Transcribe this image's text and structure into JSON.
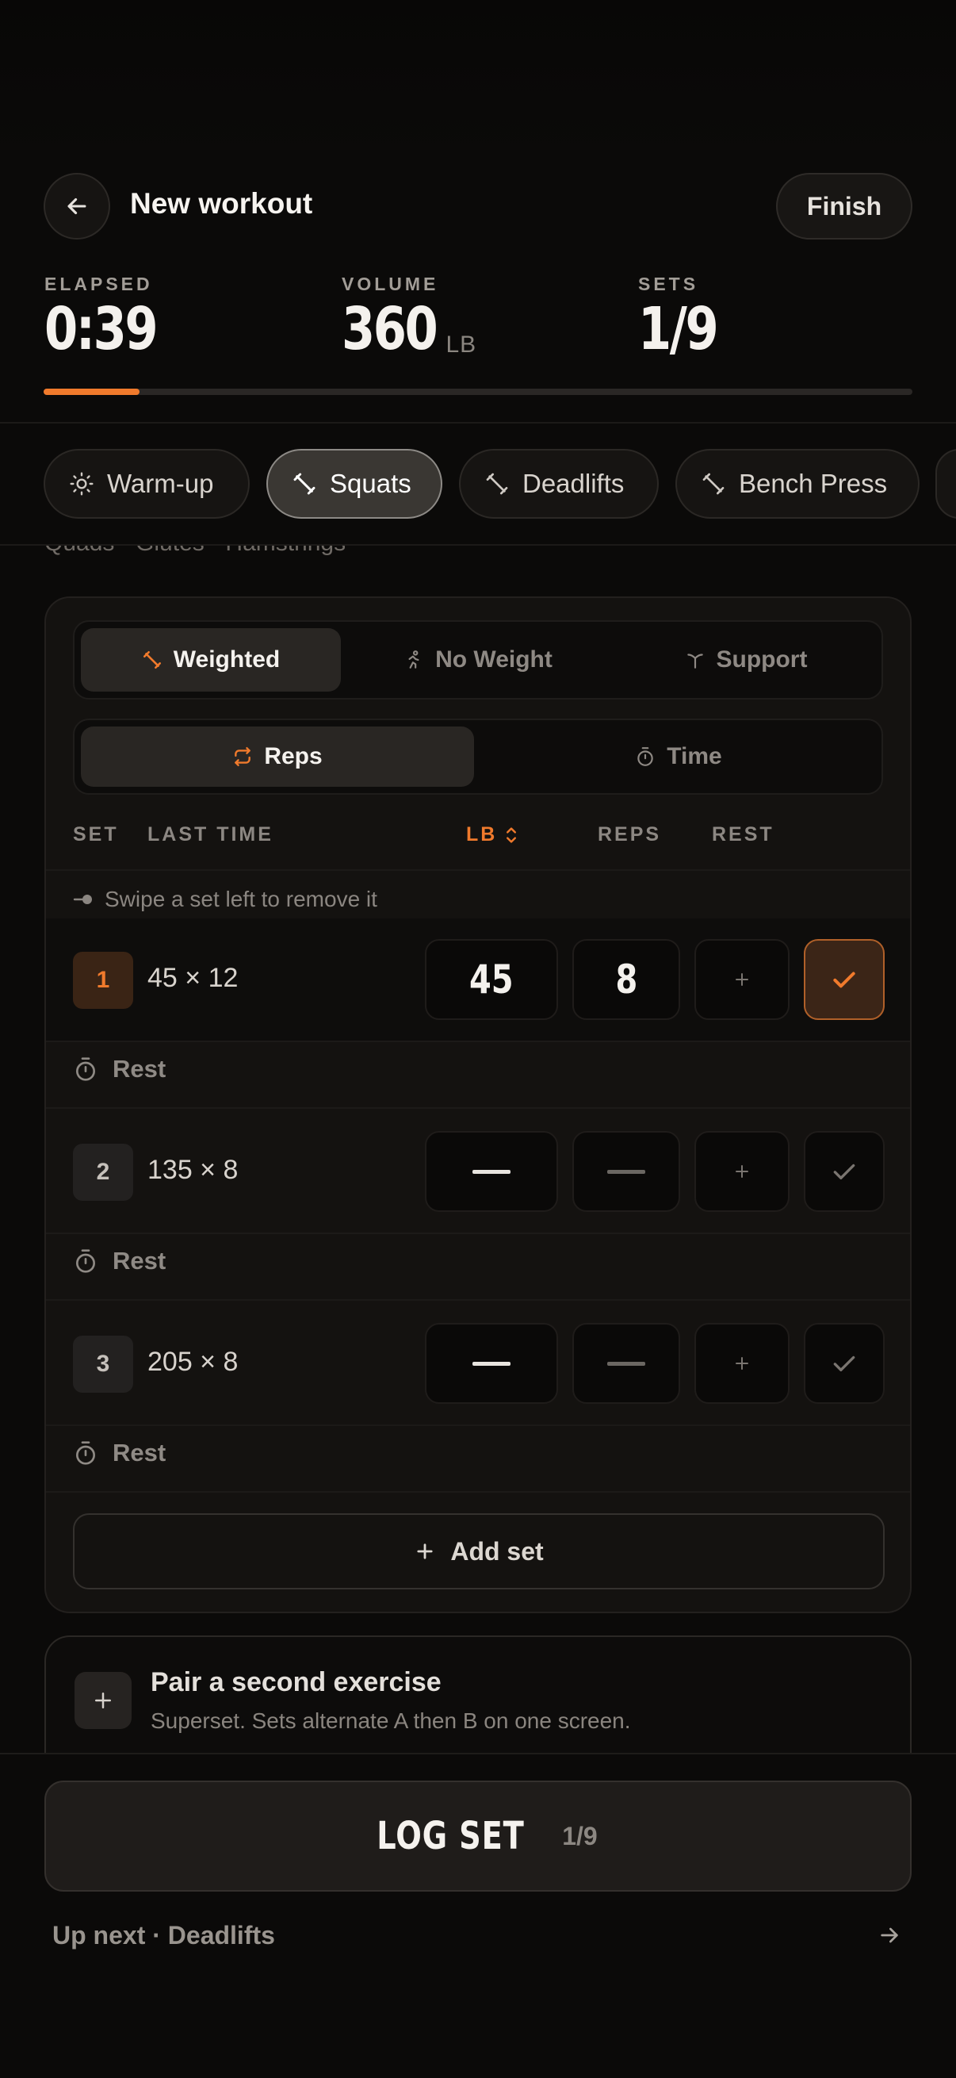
{
  "header": {
    "title": "New workout",
    "finish_label": "Finish"
  },
  "stats": {
    "elapsed_label": "ELAPSED",
    "elapsed_value": "0:39",
    "volume_label": "VOLUME",
    "volume_value": "360",
    "volume_unit": "LB",
    "sets_label": "SETS",
    "sets_value": "1/9",
    "progress_fraction": 0.11
  },
  "exercise_tabs": [
    {
      "label": "Warm-up",
      "icon": "sun-icon",
      "active": false
    },
    {
      "label": "Squats",
      "icon": "dumbbell-icon",
      "active": true
    },
    {
      "label": "Deadlifts",
      "icon": "dumbbell-icon",
      "active": false
    },
    {
      "label": "Bench Press",
      "icon": "dumbbell-icon",
      "active": false
    }
  ],
  "muscles_text": "Quads · Glutes · Hamstrings",
  "load_type": {
    "options": [
      "Weighted",
      "No Weight",
      "Support"
    ],
    "selected": "Weighted"
  },
  "measure_type": {
    "options": [
      "Reps",
      "Time"
    ],
    "selected": "Reps"
  },
  "columns": {
    "set": "SET",
    "last_time": "LAST TIME",
    "weight": "LB",
    "reps": "REPS",
    "rest": "REST"
  },
  "swipe_hint": "Swipe a set left to remove it",
  "sets": [
    {
      "number": "1",
      "last_time": "45 × 12",
      "weight": "45",
      "reps": "8",
      "done": true
    },
    {
      "number": "2",
      "last_time": "135 × 8",
      "weight": "",
      "reps": "",
      "done": false
    },
    {
      "number": "3",
      "last_time": "205 × 8",
      "weight": "",
      "reps": "",
      "done": false
    }
  ],
  "rest_label": "Rest",
  "add_set_label": "Add set",
  "superset": {
    "title": "Pair a second exercise",
    "subtitle": "Superset. Sets alternate A then B on one screen."
  },
  "log_set": {
    "label": "LOG SET",
    "count": "1/9"
  },
  "up_next": "Up next · Deadlifts",
  "colors": {
    "accent": "#f07a2c",
    "background": "#0b0a09",
    "card": "#141210"
  }
}
